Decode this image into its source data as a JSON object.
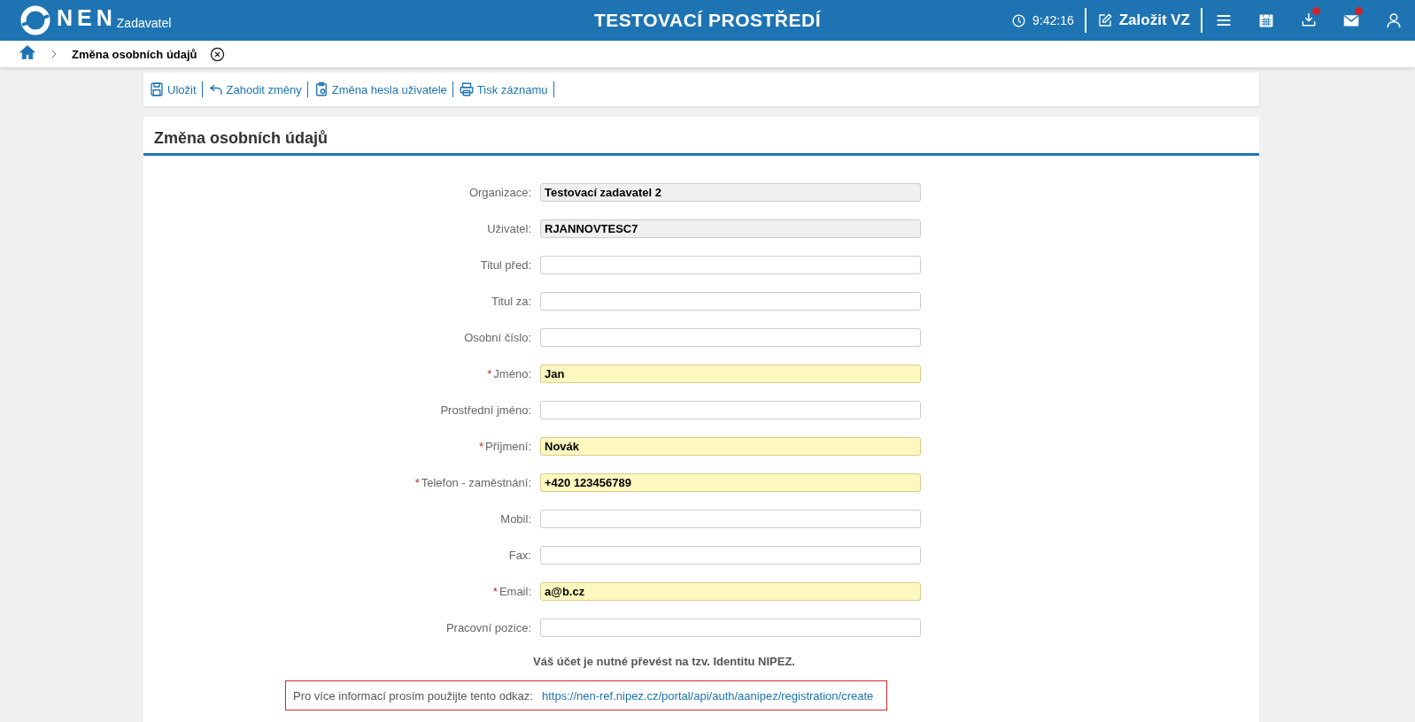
{
  "header": {
    "logo_text": "NEN",
    "logo_sub": "Zadavatel",
    "title": "TESTOVACÍ PROSTŘEDÍ",
    "time": "9:42:16",
    "create_label": "Založit VZ",
    "icons": [
      {
        "kind": "menu",
        "badge": false
      },
      {
        "kind": "calendar",
        "badge": false
      },
      {
        "kind": "download",
        "badge": true
      },
      {
        "kind": "mail",
        "badge": true
      },
      {
        "kind": "user",
        "badge": false
      }
    ]
  },
  "breadcrumb": {
    "current": "Změna osobních údajů"
  },
  "toolbar": [
    {
      "kind": "save",
      "label": "Uložit"
    },
    {
      "kind": "discard",
      "label": "Zahodit změny"
    },
    {
      "kind": "password",
      "label": "Změna hesla uživatele"
    },
    {
      "kind": "print",
      "label": "Tisk záznamu"
    }
  ],
  "form": {
    "title": "Změna osobních údajů",
    "fields": [
      {
        "label": "Organizace:",
        "value": "Testovací zadavatel 2",
        "required": false,
        "readonly": true
      },
      {
        "label": "Uživatel:",
        "value": "RJANNOVTESC7",
        "required": false,
        "readonly": true
      },
      {
        "label": "Titul před:",
        "required": false,
        "readonly": false
      },
      {
        "label": "Titul za:",
        "required": false,
        "readonly": false
      },
      {
        "label": "Osobní číslo:",
        "required": false,
        "readonly": false
      },
      {
        "label": "Jméno:",
        "required_mark": "*",
        "value": "Jan",
        "required": true,
        "readonly": false
      },
      {
        "label": "Prostřední jméno:",
        "required": false,
        "readonly": false
      },
      {
        "label": "Příjmení:",
        "required_mark": "*",
        "value": "Novák",
        "required": true,
        "readonly": false
      },
      {
        "label": "Telefon - zaměstnání:",
        "required_mark": "*",
        "value": "+420 123456789",
        "required": true,
        "readonly": false
      },
      {
        "label": "Mobil:",
        "required": false,
        "readonly": false
      },
      {
        "label": "Fax:",
        "required": false,
        "readonly": false
      },
      {
        "label": "Email:",
        "required_mark": "*",
        "value": "a@b.cz",
        "required": true,
        "readonly": false
      },
      {
        "label": "Pracovní pozice:",
        "required": false,
        "readonly": false
      }
    ],
    "notice": "Váš účet je nutné převést na tzv. Identitu NIPEZ.",
    "info_label": "Pro více informací prosím použijte tento odkaz:",
    "info_link": "https://nen-ref.nipez.cz/portal/api/auth/aanipez/registration/create"
  }
}
